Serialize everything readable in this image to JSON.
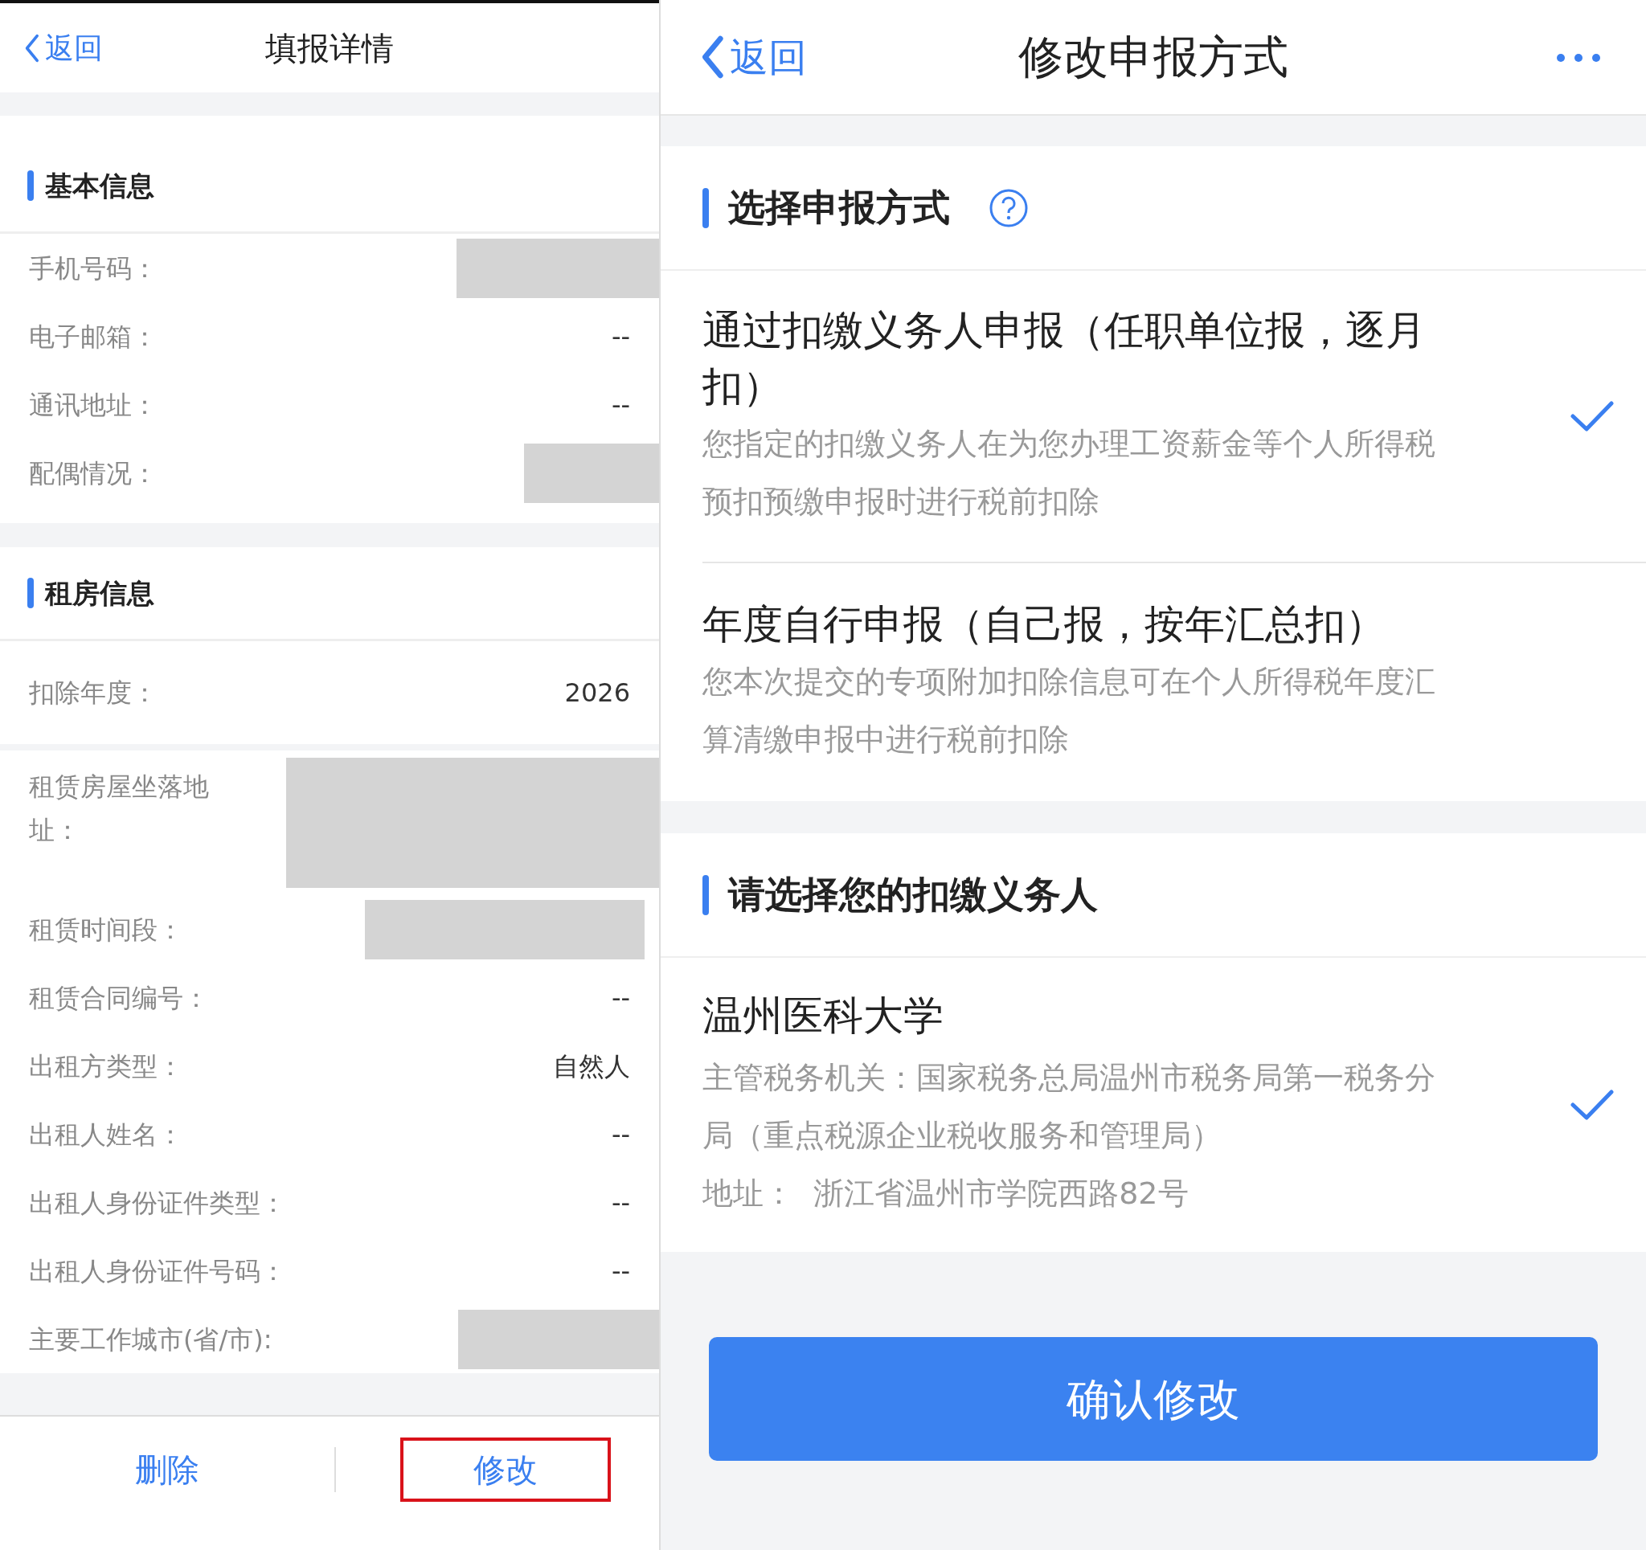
{
  "left_screen": {
    "header": {
      "back": "返回",
      "title": "填报详情"
    },
    "sections": [
      {
        "title": "基本信息",
        "rows": [
          {
            "label": "手机号码：",
            "kind": "redacted"
          },
          {
            "label": "电子邮箱：",
            "kind": "text",
            "value": "--"
          },
          {
            "label": "通讯地址：",
            "kind": "text",
            "value": "--"
          },
          {
            "label": "配偶情况：",
            "kind": "redacted"
          }
        ]
      },
      {
        "title": "租房信息",
        "rows": [
          {
            "label": "扣除年度：",
            "kind": "text",
            "value": "2026"
          },
          {
            "label": "租赁房屋坐落地址：",
            "kind": "redacted"
          },
          {
            "label": "租赁时间段：",
            "kind": "redacted"
          },
          {
            "label": "租赁合同编号：",
            "kind": "text",
            "value": "--"
          },
          {
            "label": "出租方类型：",
            "kind": "text",
            "value": "自然人"
          },
          {
            "label": "出租人姓名：",
            "kind": "text",
            "value": "--"
          },
          {
            "label": "出租人身份证件类型：",
            "kind": "text",
            "value": "--"
          },
          {
            "label": "出租人身份证件号码：",
            "kind": "text",
            "value": "--"
          },
          {
            "label": "主要工作城市(省/市):",
            "kind": "redacted"
          }
        ]
      }
    ],
    "actions": [
      {
        "label": "删除",
        "highlighted": false
      },
      {
        "label": "修改",
        "highlighted": true
      }
    ]
  },
  "right_screen": {
    "header": {
      "back": "返回",
      "title": "修改申报方式"
    },
    "method_section": {
      "title": "选择申报方式",
      "options": [
        {
          "title": "通过扣缴义务人申报（任职单位报，逐月扣）",
          "description": "您指定的扣缴义务人在为您办理工资薪金等个人所得税预扣预缴申报时进行税前扣除",
          "selected": true
        },
        {
          "title": "年度自行申报（自己报，按年汇总扣）",
          "description": "您本次提交的专项附加扣除信息可在个人所得税年度汇算清缴申报中进行税前扣除",
          "selected": false
        }
      ]
    },
    "withholder_section": {
      "title": "请选择您的扣缴义务人",
      "agents": [
        {
          "name": "温州医科大学",
          "tax_office": "主管税务机关：国家税务总局温州市税务局第一税务分局（重点税源企业税收服务和管理局）",
          "address": "地址：  浙江省温州市学院西路82号",
          "selected": true
        }
      ]
    },
    "confirm_button": "确认修改"
  }
}
